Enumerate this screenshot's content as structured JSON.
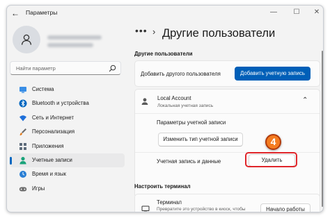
{
  "window": {
    "title": "Параметры",
    "back_icon": "arrow-left-icon",
    "controls": [
      "minimize-icon",
      "maximize-icon",
      "close-icon"
    ]
  },
  "sidebar": {
    "search": {
      "placeholder": "Найти параметр"
    },
    "items": [
      {
        "label": "Система",
        "icon": "monitor-icon",
        "color": "#3a8ee6",
        "active": false
      },
      {
        "label": "Bluetooth и устройства",
        "icon": "bluetooth-icon",
        "color": "#0067c0",
        "active": false
      },
      {
        "label": "Сеть и Интернет",
        "icon": "wifi-icon",
        "color": "#1e6fd9",
        "active": false
      },
      {
        "label": "Персонализация",
        "icon": "brush-icon",
        "color": "#e07b1d",
        "active": false
      },
      {
        "label": "Приложения",
        "icon": "apps-icon",
        "color": "#5d6b7a",
        "active": false
      },
      {
        "label": "Учетные записи",
        "icon": "person-icon",
        "color": "#1aa37a",
        "active": true
      },
      {
        "label": "Время и язык",
        "icon": "globe-clock-icon",
        "color": "#2a7fd4",
        "active": false
      },
      {
        "label": "Игры",
        "icon": "gamepad-icon",
        "color": "#6b6b6b",
        "active": false
      }
    ]
  },
  "main": {
    "breadcrumb_dots": "•••",
    "breadcrumb_chevron": "›",
    "page_title": "Другие пользователи",
    "section_other_users": "Другие пользователи",
    "add_user_label": "Добавить другого пользователя",
    "add_account_button": "Добавить учетную запись",
    "account": {
      "name": "Local Account",
      "type": "Локальная учетная запись",
      "options_label": "Параметры учетной записи",
      "change_type_button": "Изменить тип учетной записи",
      "account_data_label": "Учетная запись и данные",
      "delete_button": "Удалить"
    },
    "section_kiosk": "Настроить терминал",
    "kiosk": {
      "title": "Терминал",
      "description": "Превратите это устройство в киоск, чтобы",
      "button": "Начало работы"
    }
  },
  "annotation": {
    "step_number": "4",
    "accent_color": "#e0262b",
    "badge_color": "#f47c20"
  },
  "colors": {
    "accent": "#005fb8",
    "active_indicator": "#0067c0"
  }
}
